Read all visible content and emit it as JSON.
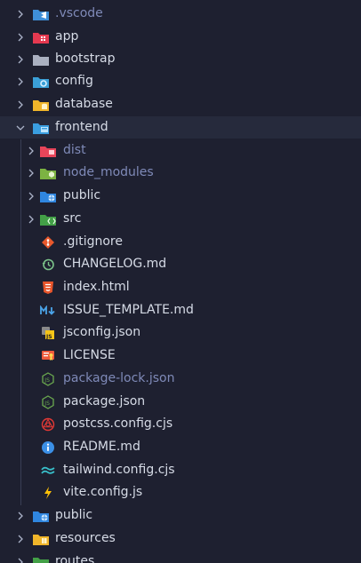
{
  "explorer": {
    "items": [
      {
        "label": ".vscode",
        "icon": "vscode-folder-icon",
        "kind": "folder",
        "state": "collapsed",
        "dim": true
      },
      {
        "label": "app",
        "icon": "app-folder-icon",
        "kind": "folder",
        "state": "collapsed"
      },
      {
        "label": "bootstrap",
        "icon": "folder-icon",
        "kind": "folder",
        "state": "collapsed"
      },
      {
        "label": "config",
        "icon": "config-folder-icon",
        "kind": "folder",
        "state": "collapsed"
      },
      {
        "label": "database",
        "icon": "database-folder-icon",
        "kind": "folder",
        "state": "collapsed"
      },
      {
        "label": "frontend",
        "icon": "frontend-folder-icon",
        "kind": "folder",
        "state": "expanded"
      },
      {
        "label": "dist",
        "icon": "dist-folder-icon",
        "kind": "folder",
        "state": "collapsed",
        "dim": true
      },
      {
        "label": "node_modules",
        "icon": "node-modules-folder-icon",
        "kind": "folder",
        "state": "collapsed",
        "dim": true
      },
      {
        "label": "public",
        "icon": "public-folder-icon",
        "kind": "folder",
        "state": "collapsed"
      },
      {
        "label": "src",
        "icon": "src-folder-icon",
        "kind": "folder",
        "state": "collapsed"
      },
      {
        "label": ".gitignore",
        "icon": "git-icon",
        "kind": "file"
      },
      {
        "label": "CHANGELOG.md",
        "icon": "changelog-icon",
        "kind": "file"
      },
      {
        "label": "index.html",
        "icon": "html5-icon",
        "kind": "file"
      },
      {
        "label": "ISSUE_TEMPLATE.md",
        "icon": "markdown-icon",
        "kind": "file"
      },
      {
        "label": "jsconfig.json",
        "icon": "jsconfig-icon",
        "kind": "file"
      },
      {
        "label": "LICENSE",
        "icon": "license-icon",
        "kind": "file"
      },
      {
        "label": "package-lock.json",
        "icon": "nodejs-icon",
        "kind": "file",
        "dim": true
      },
      {
        "label": "package.json",
        "icon": "nodejs-icon",
        "kind": "file"
      },
      {
        "label": "postcss.config.cjs",
        "icon": "postcss-icon",
        "kind": "file"
      },
      {
        "label": "README.md",
        "icon": "info-icon",
        "kind": "file"
      },
      {
        "label": "tailwind.config.cjs",
        "icon": "tailwind-icon",
        "kind": "file"
      },
      {
        "label": "vite.config.js",
        "icon": "vite-icon",
        "kind": "file"
      },
      {
        "label": "public",
        "icon": "public-folder-icon",
        "kind": "folder",
        "state": "collapsed"
      },
      {
        "label": "resources",
        "icon": "resources-folder-icon",
        "kind": "folder",
        "state": "collapsed"
      },
      {
        "label": "routes",
        "icon": "routes-folder-icon",
        "kind": "folder",
        "state": "collapsed"
      }
    ]
  },
  "colors": {
    "background": "#1e2030",
    "text": "#d6dbe6",
    "dim_text": "#7f8ab8",
    "chevron": "#aab2c8"
  }
}
